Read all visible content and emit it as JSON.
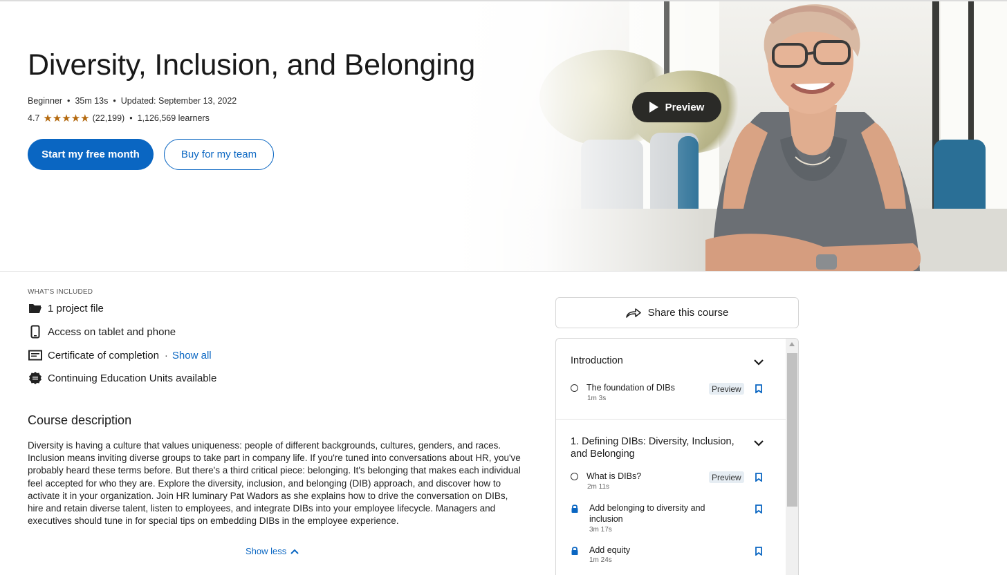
{
  "course": {
    "title": "Diversity, Inclusion, and Belonging",
    "level": "Beginner",
    "duration": "35m 13s",
    "updated": "Updated: September 13, 2022",
    "rating": "4.7",
    "stars": "★★★★★",
    "rating_count": "(22,199)",
    "learners": "1,126,569 learners",
    "separator": "•"
  },
  "actions": {
    "primary_label": "Start my free month",
    "secondary_label": "Buy for my team",
    "preview_label": "Preview"
  },
  "included": {
    "label": "WHAT'S INCLUDED",
    "items": [
      {
        "text": "1 project file",
        "icon": "folder-icon"
      },
      {
        "text": "Access on tablet and phone",
        "icon": "phone-icon"
      },
      {
        "text": "Certificate of completion",
        "icon": "certificate-icon"
      },
      {
        "text": "Continuing Education Units available",
        "icon": "badge-icon"
      }
    ],
    "separator": "·",
    "show_all": "Show all"
  },
  "description": {
    "title": "Course description",
    "text": "Diversity is having a culture that values uniqueness: people of different backgrounds, cultures, genders, and races. Inclusion means inviting diverse groups to take part in company life. If you're tuned into conversations about HR, you've probably heard these terms before. But there's a third critical piece: belonging. It's belonging that makes each individual feel accepted for who they are. Explore the diversity, inclusion, and belonging (DIB) approach, and discover how to activate it in your organization. Join HR luminary Pat Wadors as she explains how to drive the conversation on DIBs, hire and retain diverse talent, listen to employees, and integrate DIBs into your employee lifecycle. Managers and executives should tune in for special tips on embedding DIBs in the employee experience.",
    "show_less": "Show less"
  },
  "share": {
    "label": "Share this course"
  },
  "toc": {
    "chapters": [
      {
        "title": "Introduction",
        "items": [
          {
            "title": "The foundation of DIBs",
            "duration": "1m 3s",
            "badge": "Preview",
            "locked": false
          }
        ]
      },
      {
        "title": "1. Defining DIBs: Diversity, Inclusion, and Belonging",
        "items": [
          {
            "title": "What is DIBs?",
            "duration": "2m 11s",
            "badge": "Preview",
            "locked": false
          },
          {
            "title": "Add belonging to diversity and inclusion",
            "duration": "3m 17s",
            "badge": "",
            "locked": true
          },
          {
            "title": "Add equity",
            "duration": "1m 24s",
            "badge": "",
            "locked": true
          }
        ]
      }
    ]
  },
  "colors": {
    "accent": "#0a66c2",
    "star": "#b4690e",
    "dark_button": "#2a2a27"
  }
}
